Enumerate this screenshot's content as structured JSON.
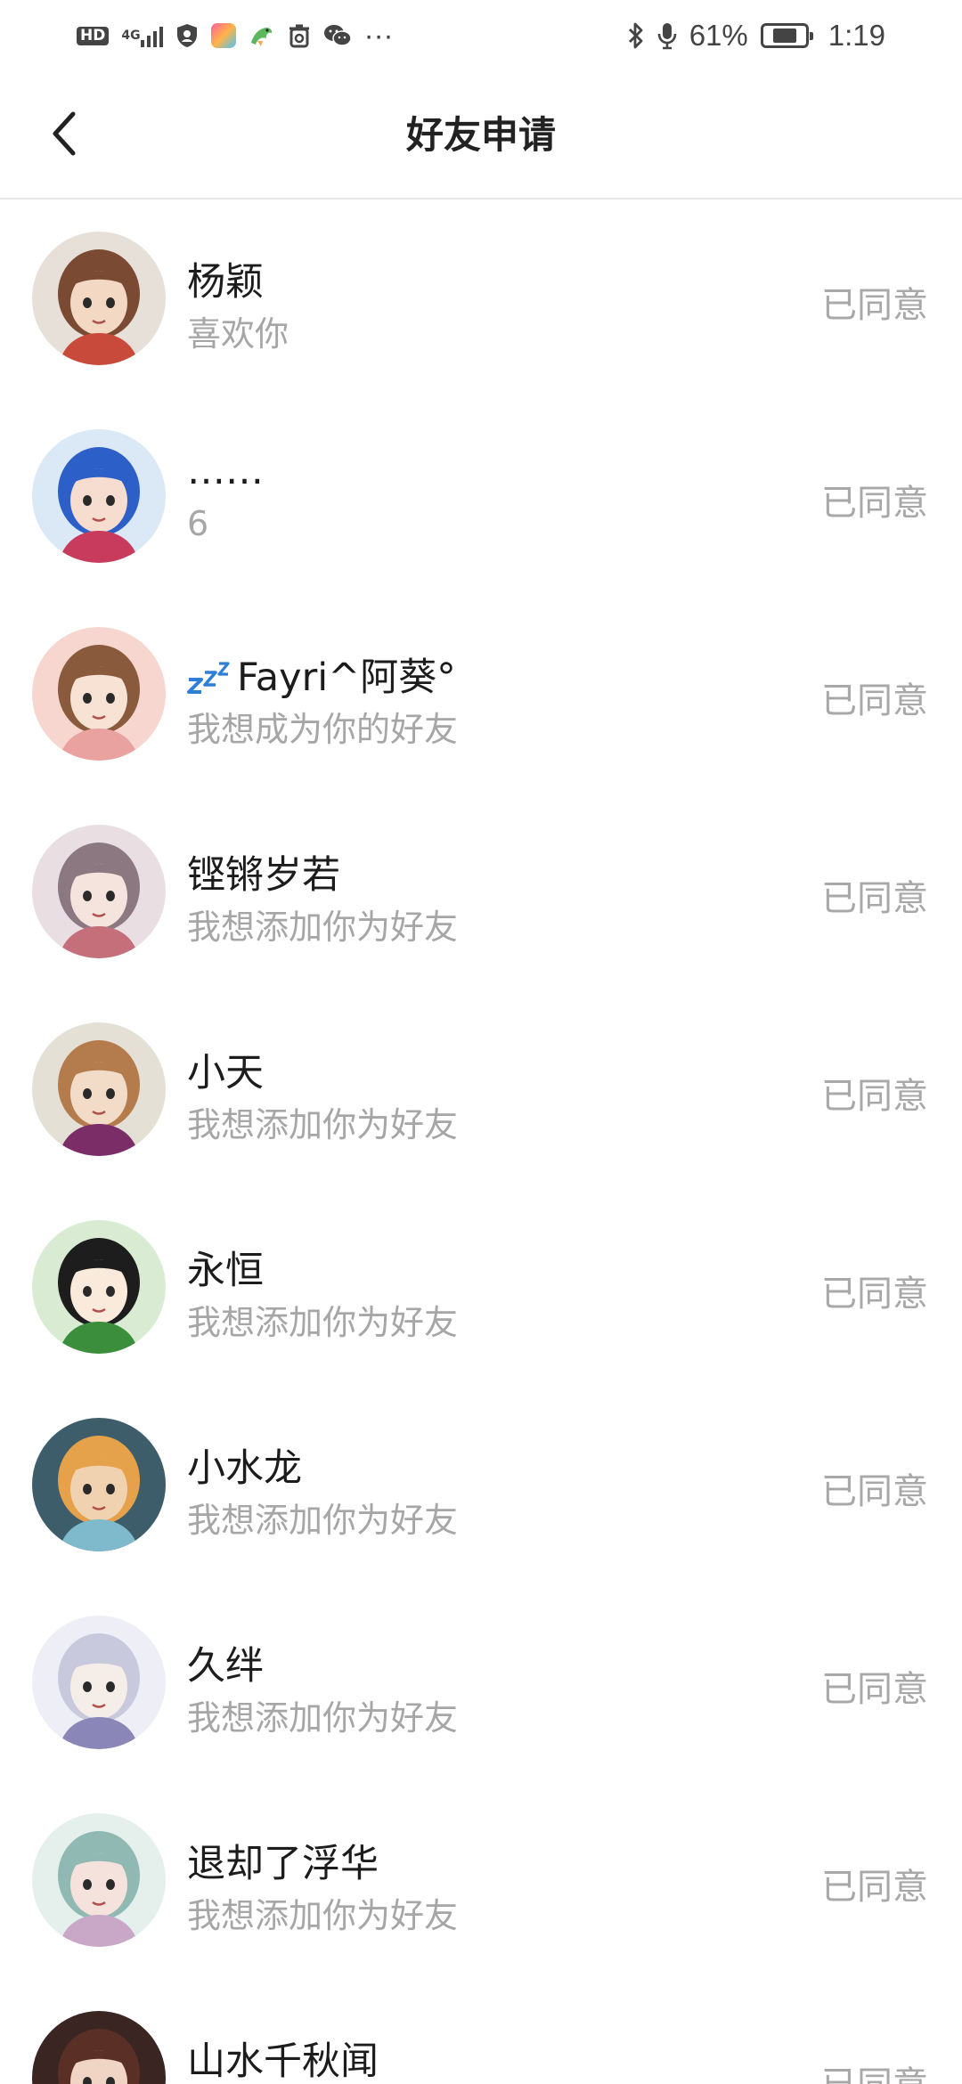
{
  "status_bar": {
    "hd_label": "HD",
    "network_label": "4G",
    "battery_text": "61%",
    "battery_level_percent": 61,
    "time": "1:19",
    "more_glyph": "···",
    "icons": [
      "hd-icon",
      "signal-icon",
      "shield-icon",
      "app-icon",
      "dragon-icon",
      "recycle-icon",
      "wechat-icon",
      "bluetooth-icon",
      "mic-icon",
      "battery-icon"
    ]
  },
  "header": {
    "title": "好友申请",
    "back_icon": "chevron-left-icon"
  },
  "requests": [
    {
      "name": "杨颖",
      "message": "喜欢你",
      "status": "已同意",
      "avatar_colors": [
        "#e7e0d8",
        "#7a4a33",
        "#f3d8c4",
        "#c84a3a"
      ]
    },
    {
      "name": "……",
      "message": "6",
      "status": "已同意",
      "avatar_colors": [
        "#dbe8f5",
        "#2d5fc9",
        "#f7dcd0",
        "#c93b5d"
      ]
    },
    {
      "name": "Fayri^阿葵°",
      "message": "我想成为你的好友",
      "status": "已同意",
      "avatar_colors": [
        "#f6d6cf",
        "#8a5a3c",
        "#f7e2d3",
        "#e9a2a0"
      ]
    },
    {
      "name": "铿锵岁若",
      "message": "我想添加你为好友",
      "status": "已同意",
      "avatar_colors": [
        "#e9dfe3",
        "#8b7880",
        "#f5e3dd",
        "#c56f7a"
      ]
    },
    {
      "name": "小天",
      "message": "我想添加你为好友",
      "status": "已同意",
      "avatar_colors": [
        "#e5e0d6",
        "#b47c4d",
        "#f3dcc7",
        "#7a2d66"
      ]
    },
    {
      "name": "永恒",
      "message": "我想添加你为好友",
      "status": "已同意",
      "avatar_colors": [
        "#d9ecd3",
        "#1d1d1d",
        "#f9eadc",
        "#3b8f3c"
      ]
    },
    {
      "name": "小水龙",
      "message": "我想添加你为好友",
      "status": "已同意",
      "avatar_colors": [
        "#3e5d6b",
        "#e5a24b",
        "#f1d2b0",
        "#7fb9cc"
      ]
    },
    {
      "name": "久绊",
      "message": "我想添加你为好友",
      "status": "已同意",
      "avatar_colors": [
        "#eeeef6",
        "#c9c9dd",
        "#f5ede8",
        "#8a86b8"
      ]
    },
    {
      "name": "退却了浮华",
      "message": "我想添加你为好友",
      "status": "已同意",
      "avatar_colors": [
        "#e5f0ec",
        "#8fb9b2",
        "#f6e2dc",
        "#c9a7c7"
      ]
    },
    {
      "name": "山水千秋闻",
      "message": "",
      "status": "已同意",
      "avatar_colors": [
        "#3a2522",
        "#5a2f26",
        "#f0d4c4",
        "#8a3b2b"
      ]
    }
  ]
}
